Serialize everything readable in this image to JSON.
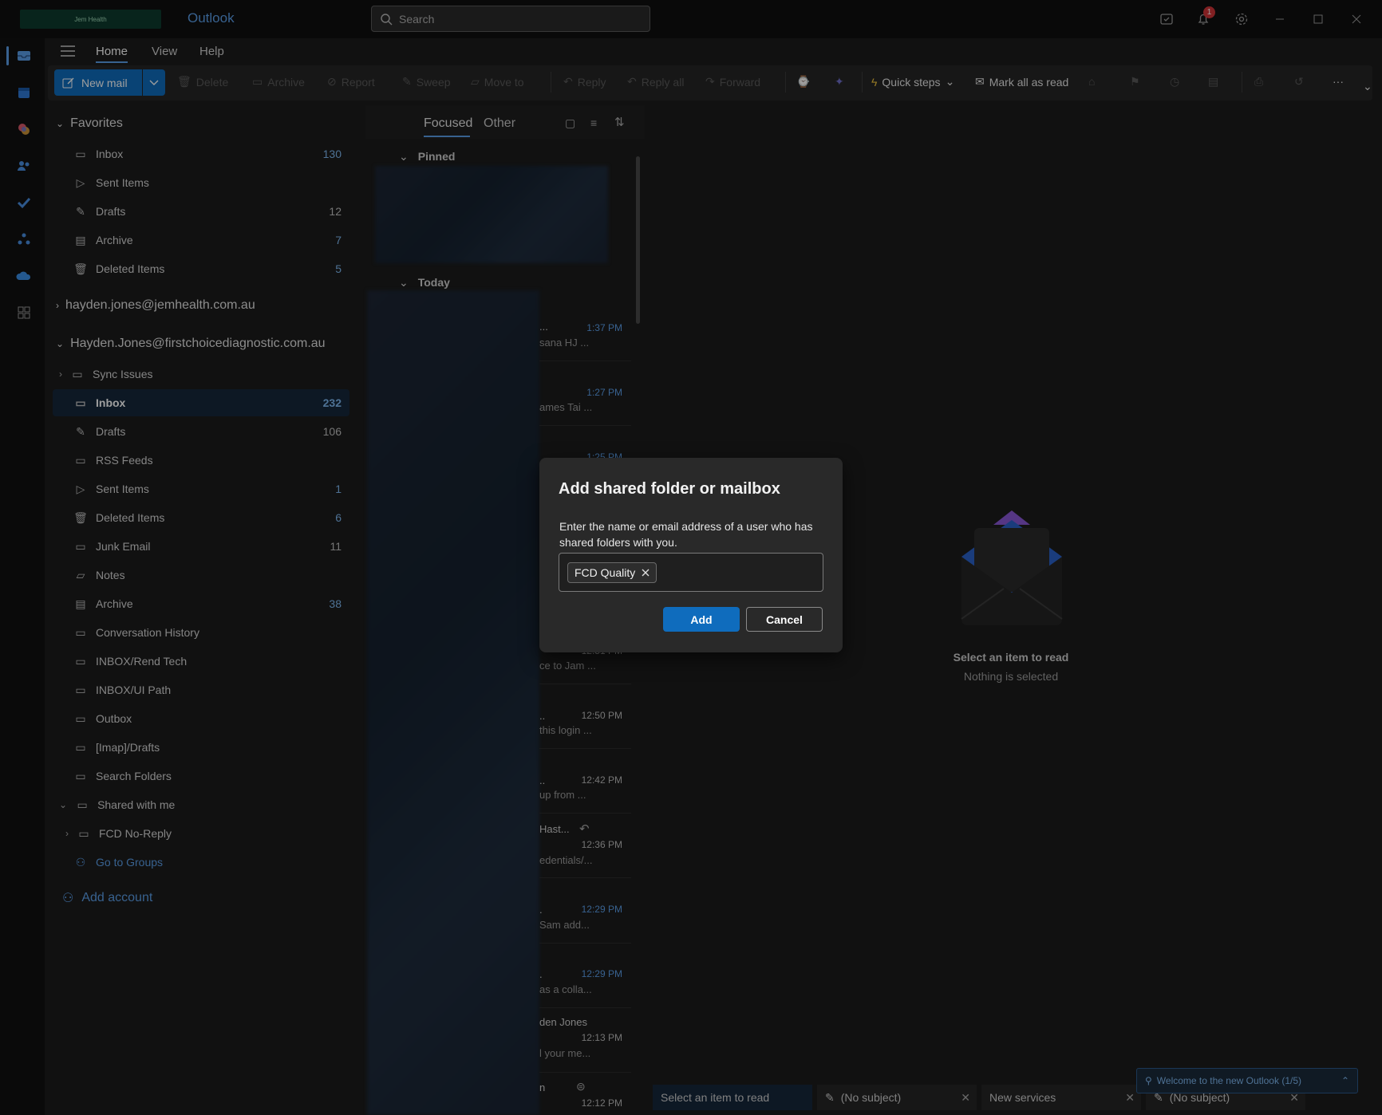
{
  "titlebar": {
    "logo_text": "Jem Health",
    "app_name": "Outlook",
    "search_placeholder": "Search",
    "notification_count": "1"
  },
  "tabs": [
    {
      "label": "Home"
    },
    {
      "label": "View"
    },
    {
      "label": "Help"
    }
  ],
  "ribbon": {
    "new_mail": "New mail",
    "delete": "Delete",
    "archive": "Archive",
    "report": "Report",
    "sweep": "Sweep",
    "move_to": "Move to",
    "reply": "Reply",
    "reply_all": "Reply all",
    "forward": "Forward",
    "quick_steps": "Quick steps",
    "mark_all_read": "Mark all as read"
  },
  "favorites": {
    "title": "Favorites",
    "items": [
      {
        "label": "Inbox",
        "count": "130"
      },
      {
        "label": "Sent Items",
        "count": ""
      },
      {
        "label": "Drafts",
        "count": "12"
      },
      {
        "label": "Archive",
        "count": "7"
      },
      {
        "label": "Deleted Items",
        "count": "5"
      }
    ]
  },
  "accounts": {
    "account1": "hayden.jones@jemhealth.com.au",
    "account2": "Hayden.Jones@firstchoicediagnostic.com.au"
  },
  "folders": [
    {
      "label": "Sync Issues",
      "count": ""
    },
    {
      "label": "Inbox",
      "count": "232"
    },
    {
      "label": "Drafts",
      "count": "106"
    },
    {
      "label": "RSS Feeds",
      "count": ""
    },
    {
      "label": "Sent Items",
      "count": "1"
    },
    {
      "label": "Deleted Items",
      "count": "6"
    },
    {
      "label": "Junk Email",
      "count": "11"
    },
    {
      "label": "Notes",
      "count": ""
    },
    {
      "label": "Archive",
      "count": "38"
    },
    {
      "label": "Conversation History",
      "count": ""
    },
    {
      "label": "INBOX/Rend Tech",
      "count": ""
    },
    {
      "label": "INBOX/UI Path",
      "count": ""
    },
    {
      "label": "Outbox",
      "count": ""
    },
    {
      "label": "[Imap]/Drafts",
      "count": ""
    },
    {
      "label": "Search Folders",
      "count": ""
    }
  ],
  "shared": {
    "title": "Shared with me",
    "item": "FCD No-Reply",
    "groups": "Go to Groups"
  },
  "add_account": "Add account",
  "message_list": {
    "tab_focused": "Focused",
    "tab_other": "Other",
    "group_pinned": "Pinned",
    "group_today": "Today",
    "messages": [
      {
        "sender": "...",
        "time": "1:37 PM",
        "preview": "sana HJ ..."
      },
      {
        "sender": "",
        "time": "1:27 PM",
        "preview": "ames Tai ..."
      },
      {
        "sender": "",
        "time": "1:25 PM",
        "preview": ""
      },
      {
        "sender": "",
        "time": "12:51 PM",
        "preview": "ce to Jam ..."
      },
      {
        "sender": "..",
        "time": "12:50 PM",
        "preview": "this login ..."
      },
      {
        "sender": "..",
        "time": "12:42 PM",
        "preview": "up from ..."
      },
      {
        "sender": "Hast...",
        "time": "12:36 PM",
        "preview": "edentials/..."
      },
      {
        "sender": ".",
        "time": "12:29 PM",
        "preview": "Sam add..."
      },
      {
        "sender": ".",
        "time": "12:29 PM",
        "preview": "as a colla..."
      },
      {
        "sender": "den Jones",
        "time": "12:13 PM",
        "preview": "l your me..."
      },
      {
        "sender": "n",
        "time": "12:12 PM",
        "preview": ""
      }
    ]
  },
  "reading_pane": {
    "title": "Select an item to read",
    "subtitle": "Nothing is selected"
  },
  "bottom_tabs": [
    {
      "label": "Select an item to read"
    },
    {
      "label": "(No subject)"
    },
    {
      "label": "New services"
    },
    {
      "label": "(No subject)"
    }
  ],
  "welcome": "Welcome to the new Outlook  (1/5)",
  "dialog": {
    "title": "Add shared folder or mailbox",
    "description": "Enter the name or email address of a user who has shared folders with you.",
    "chip": "FCD Quality",
    "add": "Add",
    "cancel": "Cancel"
  },
  "colors": {
    "accent": "#0f6cbd",
    "link": "#5b9ee8",
    "background": "#1c1c1c",
    "badge": "#d13438"
  }
}
